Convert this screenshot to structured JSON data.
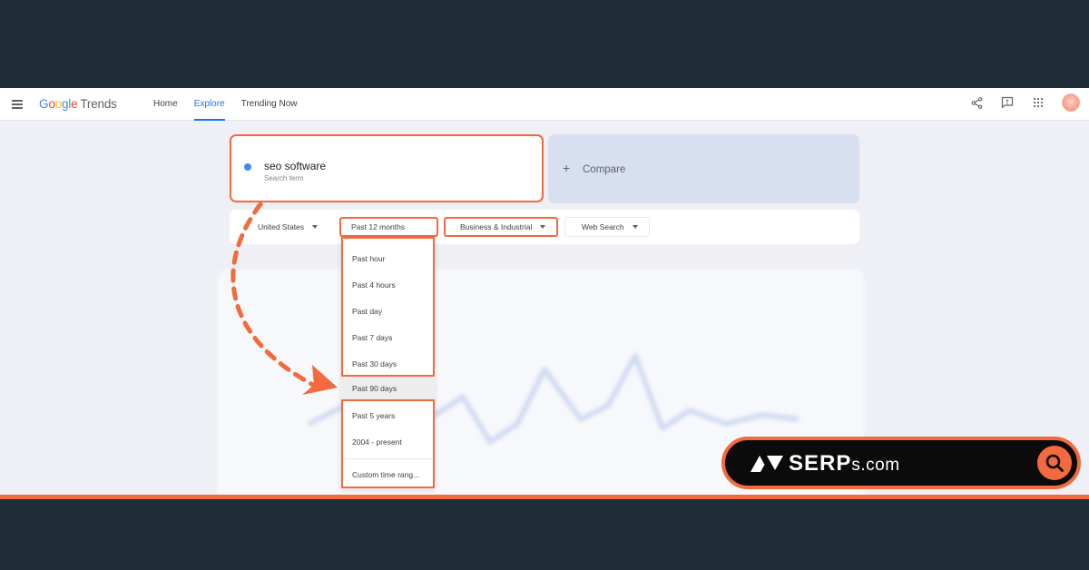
{
  "topbar": {
    "logo_letters": [
      "G",
      "o",
      "o",
      "g",
      "l",
      "e"
    ],
    "logo_product": "Trends",
    "nav": [
      {
        "label": "Home",
        "active": false
      },
      {
        "label": "Explore",
        "active": true
      },
      {
        "label": "Trending Now",
        "active": false
      }
    ],
    "icons": [
      "share-icon",
      "feedback-icon",
      "apps-grid-icon",
      "avatar"
    ]
  },
  "search": {
    "term": "seo software",
    "sublabel": "Search term",
    "dot_color": "#4285f4"
  },
  "compare": {
    "label": "Compare"
  },
  "filters": {
    "region": "United States",
    "time": "Past 12 months",
    "category": "Business & Industrial",
    "property": "Web Search"
  },
  "dropdown": {
    "options": [
      "Past hour",
      "Past 4 hours",
      "Past day",
      "Past 7 days",
      "Past 30 days",
      "Past 90 days",
      "Past 5 years",
      "2004 - present"
    ],
    "selected": "Past 90 days",
    "custom": "Custom time rang..."
  },
  "badge": {
    "brand_main": "SERP",
    "brand_suffix": "s.com"
  },
  "colors": {
    "background": "#1f2d39",
    "accent": "#f26a3d",
    "link": "#1a73e8",
    "compare_card": "#d8dff0"
  }
}
